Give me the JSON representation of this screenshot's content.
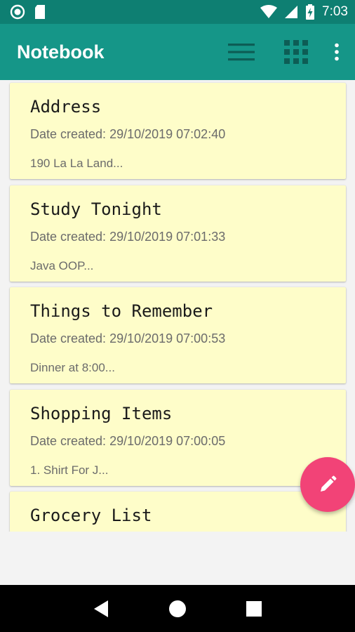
{
  "status_bar": {
    "time": "7:03"
  },
  "app_bar": {
    "title": "Notebook",
    "actions": [
      "list-view-icon",
      "grid-view-icon",
      "more-vert-icon"
    ]
  },
  "notes": [
    {
      "title": "Address",
      "date": "Date created: 29/10/2019 07:02:40",
      "preview": "190 La La Land..."
    },
    {
      "title": "Study Tonight",
      "date": "Date created: 29/10/2019 07:01:33",
      "preview": "Java OOP..."
    },
    {
      "title": "Things to Remember",
      "date": "Date created: 29/10/2019 07:00:53",
      "preview": "Dinner at 8:00..."
    },
    {
      "title": "Shopping Items",
      "date": "Date created: 29/10/2019 07:00:05",
      "preview": "1. Shirt For J..."
    },
    {
      "title": "Grocery List",
      "date": "",
      "preview": ""
    }
  ],
  "fab": {
    "icon": "pencil-icon"
  },
  "colors": {
    "status_bar": "#0e7f72",
    "app_bar": "#159688",
    "card": "#fefdc9",
    "fab": "#f24377"
  }
}
